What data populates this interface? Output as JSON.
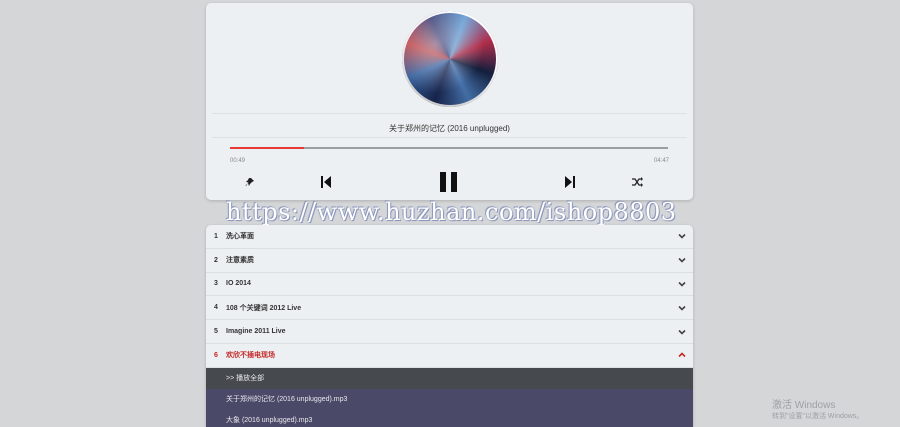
{
  "player": {
    "song_title": "关于郑州的记忆 (2016 unplugged)",
    "current_time": "00:49",
    "total_time": "04:47",
    "progress_fraction": 0.17,
    "accent": "#e53935"
  },
  "watermark": "https://www.huzhan.com/ishop8803",
  "playlist": {
    "albums": [
      {
        "num": "1",
        "name": "洗心革面"
      },
      {
        "num": "2",
        "name": "注意素质"
      },
      {
        "num": "3",
        "name": "IO 2014"
      },
      {
        "num": "4",
        "name": "108 个关键词 2012 Live"
      },
      {
        "num": "5",
        "name": "Imagine 2011 Live"
      },
      {
        "num": "6",
        "name": "欢欣不插电现场"
      }
    ],
    "play_all": ">> 播放全部",
    "tracks": [
      "关于郑州的记忆 (2016 unplugged).mp3",
      "大象 (2016 unplugged).mp3"
    ]
  },
  "windows": {
    "line1": "激活 Windows",
    "line2": "转到\"设置\"以激活 Windows。"
  }
}
